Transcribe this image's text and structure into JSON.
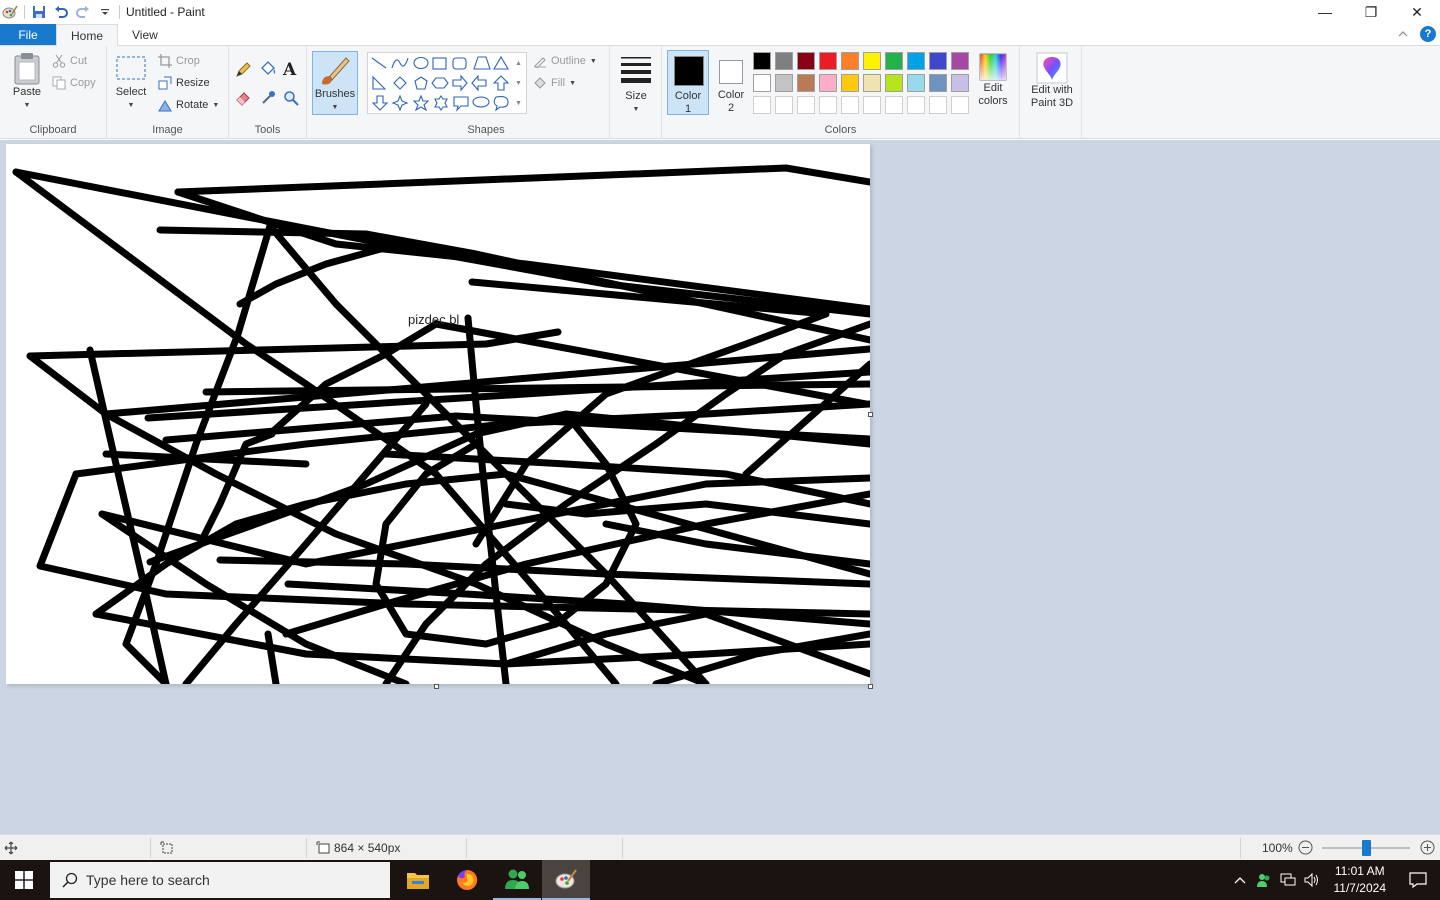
{
  "window": {
    "title": "Untitled - Paint",
    "minimize_glyph": "—",
    "restore_glyph": "❐",
    "close_glyph": "✕"
  },
  "tabs": [
    {
      "label": "File"
    },
    {
      "label": "Home"
    },
    {
      "label": "View"
    }
  ],
  "ribbon": {
    "clipboard": {
      "paste": "Paste",
      "cut": "Cut",
      "copy": "Copy",
      "label": "Clipboard"
    },
    "image": {
      "select": "Select",
      "crop": "Crop",
      "resize": "Resize",
      "rotate": "Rotate",
      "label": "Image"
    },
    "tools": {
      "label": "Tools"
    },
    "brushes": {
      "label": "Brushes"
    },
    "shapes": {
      "outline": "Outline",
      "fill": "Fill",
      "label": "Shapes"
    },
    "size": {
      "label": "Size"
    },
    "colors": {
      "color1_line1": "Color",
      "color1_line2": "1",
      "color2_line1": "Color",
      "color2_line2": "2",
      "edit_line1": "Edit",
      "edit_line2": "colors",
      "label": "Colors",
      "palette_row1": [
        "#000000",
        "#7f7f7f",
        "#880015",
        "#ed1c24",
        "#ff7f27",
        "#fff200",
        "#22b14c",
        "#00a2e8",
        "#3f48cc",
        "#a349a4"
      ],
      "palette_row2": [
        "#ffffff",
        "#c3c3c3",
        "#b97a57",
        "#ffaec9",
        "#ffc90e",
        "#efe4b0",
        "#b5e61d",
        "#99d9ea",
        "#7092be",
        "#c8bfe7"
      ],
      "color1": "#000000",
      "color2": "#ffffff"
    },
    "paint3d": {
      "line1": "Edit with",
      "line2": "Paint 3D"
    }
  },
  "canvas": {
    "text": "pizdec bl"
  },
  "statusbar": {
    "dimensions": "864 × 540px",
    "zoom": "100%"
  },
  "taskbar": {
    "search_placeholder": "Type here to search",
    "time": "11:01 AM",
    "date": "11/7/2024"
  }
}
